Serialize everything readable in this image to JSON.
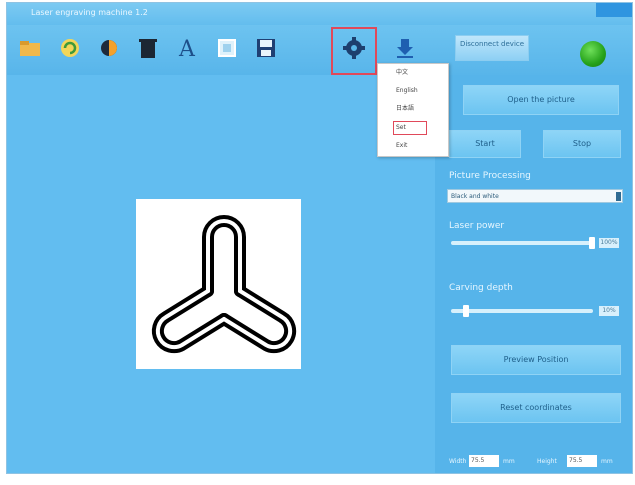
{
  "window": {
    "title": "Laser engraving machine 1.2"
  },
  "toolbar": {
    "icons": [
      "folder-icon",
      "refresh-icon",
      "brightness-icon",
      "trash-icon",
      "text-icon",
      "scan-icon",
      "save-icon",
      "gear-icon",
      "download-icon"
    ],
    "disconnect_label": "Disconnect device",
    "status_color": "#2eaa22"
  },
  "settings_menu": {
    "items": [
      "中文",
      "English",
      "日本語",
      "Set",
      "Exit"
    ],
    "highlighted": "Set"
  },
  "panel": {
    "open_picture": "Open the picture",
    "start": "Start",
    "stop": "Stop",
    "processing_label": "Picture Processing",
    "processing_value": "Black and white",
    "laser_power_label": "Laser power",
    "laser_power_value": "100%",
    "laser_power_fraction": 1.0,
    "carving_depth_label": "Carving depth",
    "carving_depth_value": "10%",
    "carving_depth_fraction": 0.1,
    "preview_button": "Preview Position",
    "reset_button": "Reset coordinates",
    "width_label": "Width",
    "width_value": "75.5",
    "width_unit": "mm",
    "height_label": "Height",
    "height_value": "75.5",
    "height_unit": "mm"
  },
  "colors": {
    "accent": "#5ab8ea",
    "highlight": "#e0495a"
  }
}
